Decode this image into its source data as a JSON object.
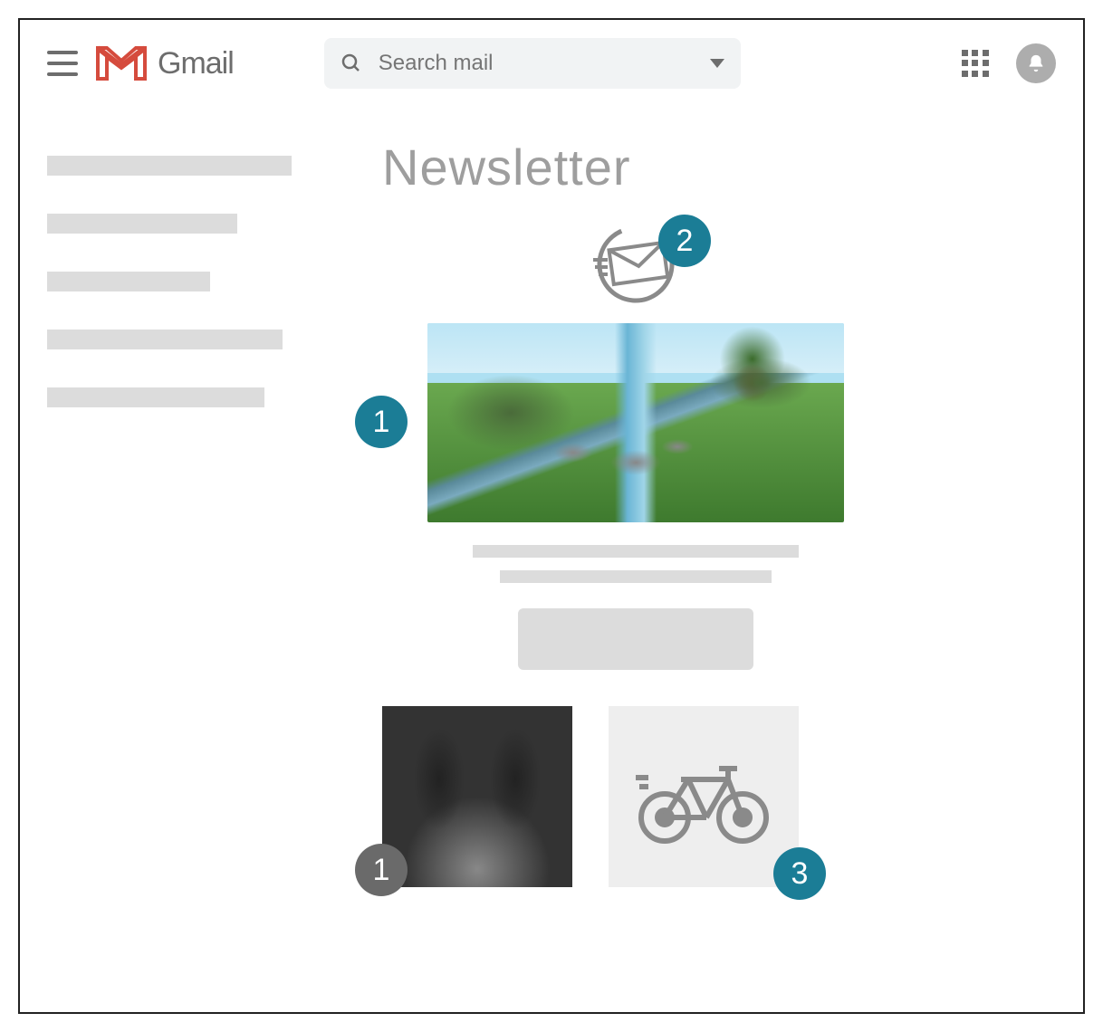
{
  "header": {
    "app_name": "Gmail",
    "search_placeholder": "Search mail"
  },
  "main": {
    "title": "Newsletter"
  },
  "annotations": {
    "badge_hero": "1",
    "badge_mail": "2",
    "badge_forest": "1",
    "badge_bike": "3"
  },
  "colors": {
    "badge": "#1b7d96",
    "skeleton": "#dcdcdc",
    "text_muted": "#9e9e9e"
  }
}
